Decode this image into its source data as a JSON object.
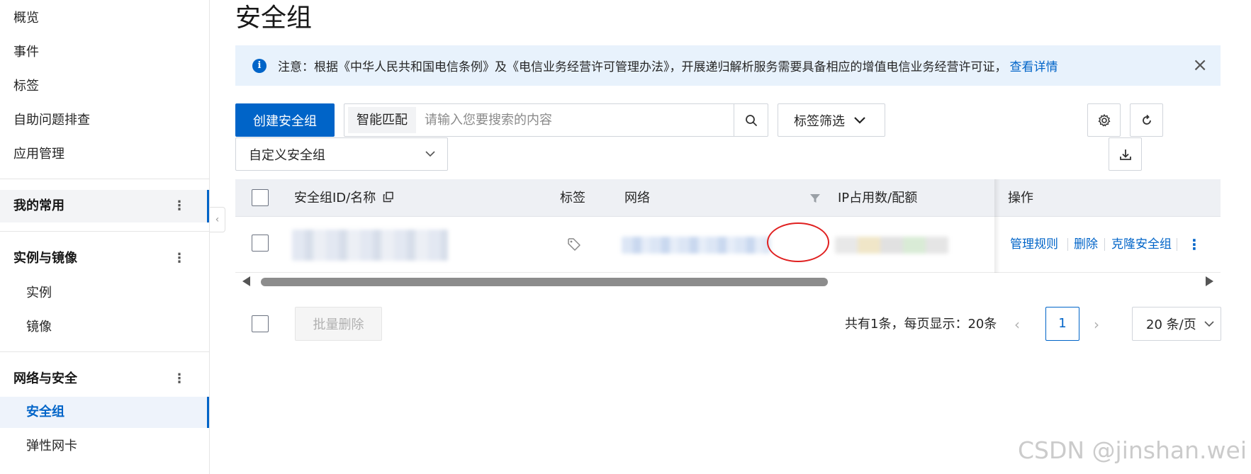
{
  "sidebar": {
    "items": [
      {
        "label": "概览"
      },
      {
        "label": "事件"
      },
      {
        "label": "标签"
      },
      {
        "label": "自助问题排查"
      },
      {
        "label": "应用管理"
      }
    ],
    "favorites": {
      "label": "我的常用"
    },
    "groups": [
      {
        "label": "实例与镜像",
        "items": [
          {
            "label": "实例"
          },
          {
            "label": "镜像"
          }
        ]
      },
      {
        "label": "网络与安全",
        "items": [
          {
            "label": "安全组",
            "active": true
          },
          {
            "label": "弹性网卡"
          }
        ]
      }
    ]
  },
  "page": {
    "title": "安全组"
  },
  "notice": {
    "text": "注意：根据《中华人民共和国电信条例》及《电信业务经营许可管理办法》，开展递归解析服务需要具备相应的增值电信业务经营许可证，",
    "link": "查看详情"
  },
  "toolbar": {
    "create_label": "创建安全组",
    "search_mode": "智能匹配",
    "search_placeholder": "请输入您要搜索的内容",
    "tag_filter_label": "标签筛选",
    "sg_type_select": "自定义安全组"
  },
  "table": {
    "columns": {
      "id_name": "安全组ID/名称",
      "tags": "标签",
      "network": "网络",
      "ip_quota": "IP占用数/配额",
      "actions": "操作"
    },
    "row_actions": {
      "manage_rules": "管理规则",
      "delete": "删除",
      "clone": "克隆安全组"
    }
  },
  "footer": {
    "batch_delete_label": "批量删除",
    "total_text": "共有1条，每页显示：20条",
    "current_page": "1",
    "page_size": "20 条/页"
  },
  "colors": {
    "accent": "#0064c8",
    "highlight": "#e02020",
    "notice_bg": "#e8f2fc"
  },
  "watermark": "CSDN @jinshan.wei"
}
